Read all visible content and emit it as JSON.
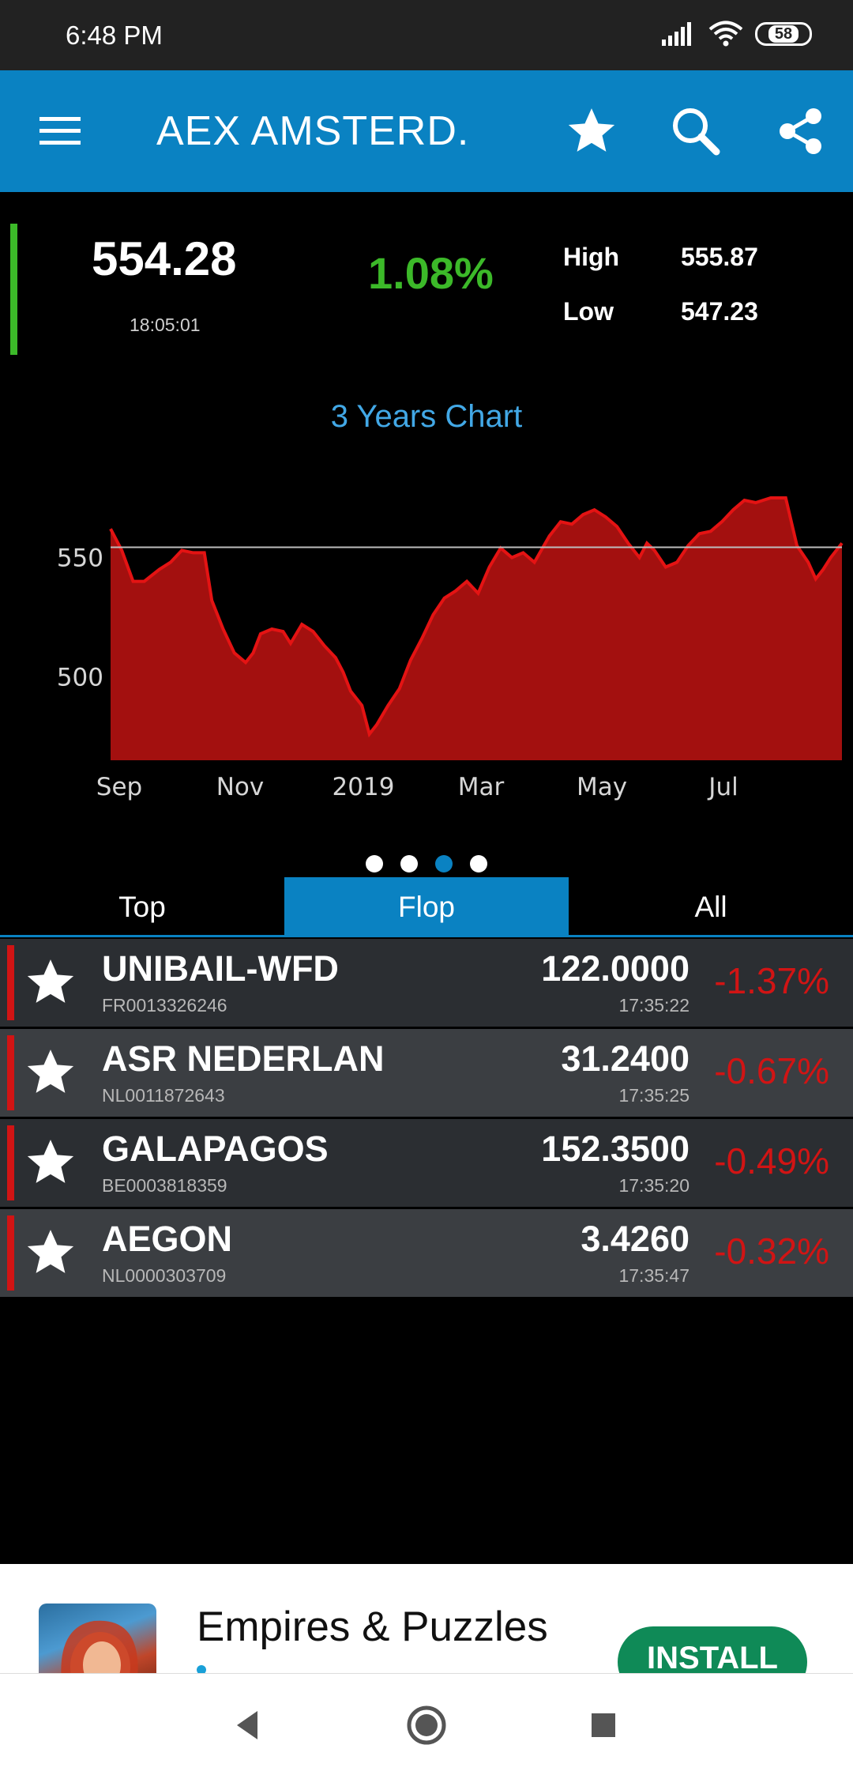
{
  "status_bar": {
    "time": "6:48 PM",
    "battery": "58"
  },
  "app_bar": {
    "title": "AEX AMSTERD.",
    "icons": [
      "menu-icon",
      "star-icon",
      "search-icon",
      "share-icon"
    ]
  },
  "quote": {
    "value": "554.28",
    "time": "18:05:01",
    "change": "1.08%",
    "high_label": "High",
    "high_value": "555.87",
    "low_label": "Low",
    "low_value": "547.23"
  },
  "chart_data": {
    "type": "area",
    "title": "3 Years Chart",
    "x_ticks": [
      "Sep",
      "Nov",
      "2019",
      "Mar",
      "May",
      "Jul"
    ],
    "y_ticks": [
      550,
      500
    ],
    "ylim": [
      465,
      575
    ],
    "reference_line": 554.28,
    "fill_color": "#a3100f",
    "line_color": "#e41313",
    "grid": false,
    "points": [
      [
        0,
        562
      ],
      [
        3,
        553
      ],
      [
        6,
        540
      ],
      [
        9,
        540
      ],
      [
        13,
        545
      ],
      [
        16,
        548
      ],
      [
        19,
        553
      ],
      [
        22,
        552
      ],
      [
        25,
        552
      ],
      [
        27,
        532
      ],
      [
        30,
        520
      ],
      [
        33,
        510
      ],
      [
        36,
        506
      ],
      [
        38,
        510
      ],
      [
        40,
        518
      ],
      [
        43,
        520
      ],
      [
        46,
        519
      ],
      [
        48,
        514
      ],
      [
        51,
        522
      ],
      [
        54,
        519
      ],
      [
        57,
        513
      ],
      [
        60,
        508
      ],
      [
        62,
        502
      ],
      [
        64,
        494
      ],
      [
        67,
        488
      ],
      [
        69,
        476
      ],
      [
        71,
        480
      ],
      [
        74,
        488
      ],
      [
        77,
        495
      ],
      [
        80,
        507
      ],
      [
        83,
        516
      ],
      [
        86,
        526
      ],
      [
        89,
        533
      ],
      [
        92,
        536
      ],
      [
        95,
        540
      ],
      [
        98,
        535
      ],
      [
        101,
        546
      ],
      [
        104,
        554
      ],
      [
        107,
        550
      ],
      [
        110,
        552
      ],
      [
        113,
        548
      ],
      [
        117,
        559
      ],
      [
        120,
        565
      ],
      [
        123,
        564
      ],
      [
        126,
        568
      ],
      [
        129,
        570
      ],
      [
        132,
        567
      ],
      [
        135,
        563
      ],
      [
        138,
        556
      ],
      [
        141,
        550
      ],
      [
        143,
        556
      ],
      [
        145,
        553
      ],
      [
        148,
        546
      ],
      [
        151,
        548
      ],
      [
        154,
        555
      ],
      [
        157,
        560
      ],
      [
        160,
        561
      ],
      [
        163,
        565
      ],
      [
        166,
        570
      ],
      [
        169,
        574
      ],
      [
        172,
        573
      ],
      [
        176,
        576
      ],
      [
        178,
        583
      ],
      [
        180,
        580
      ],
      [
        183,
        555
      ],
      [
        186,
        548
      ],
      [
        188,
        541
      ],
      [
        190,
        545
      ],
      [
        192,
        550
      ],
      [
        195,
        556
      ]
    ]
  },
  "pager": {
    "count": 4,
    "active": 2
  },
  "tabs": [
    {
      "label": "Top",
      "active": false
    },
    {
      "label": "Flop",
      "active": true
    },
    {
      "label": "All",
      "active": false
    }
  ],
  "stocks": [
    {
      "name": "UNIBAIL-WFD",
      "isin": "FR0013326246",
      "price": "122.0000",
      "time": "17:35:22",
      "change": "-1.37%"
    },
    {
      "name": "ASR NEDERLAN",
      "isin": "NL0011872643",
      "price": "31.2400",
      "time": "17:35:25",
      "change": "-0.67%"
    },
    {
      "name": "GALAPAGOS",
      "isin": "BE0003818359",
      "price": "152.3500",
      "time": "17:35:20",
      "change": "-0.49%"
    },
    {
      "name": "AEGON",
      "isin": "NL0000303709",
      "price": "3.4260",
      "time": "17:35:47",
      "change": "-0.32%"
    }
  ],
  "ad": {
    "title": "Empires & Puzzles",
    "install_label": "INSTALL",
    "icon": "game-app-icon"
  },
  "nav": {
    "icons": [
      "back-icon",
      "home-icon",
      "recents-icon"
    ]
  }
}
